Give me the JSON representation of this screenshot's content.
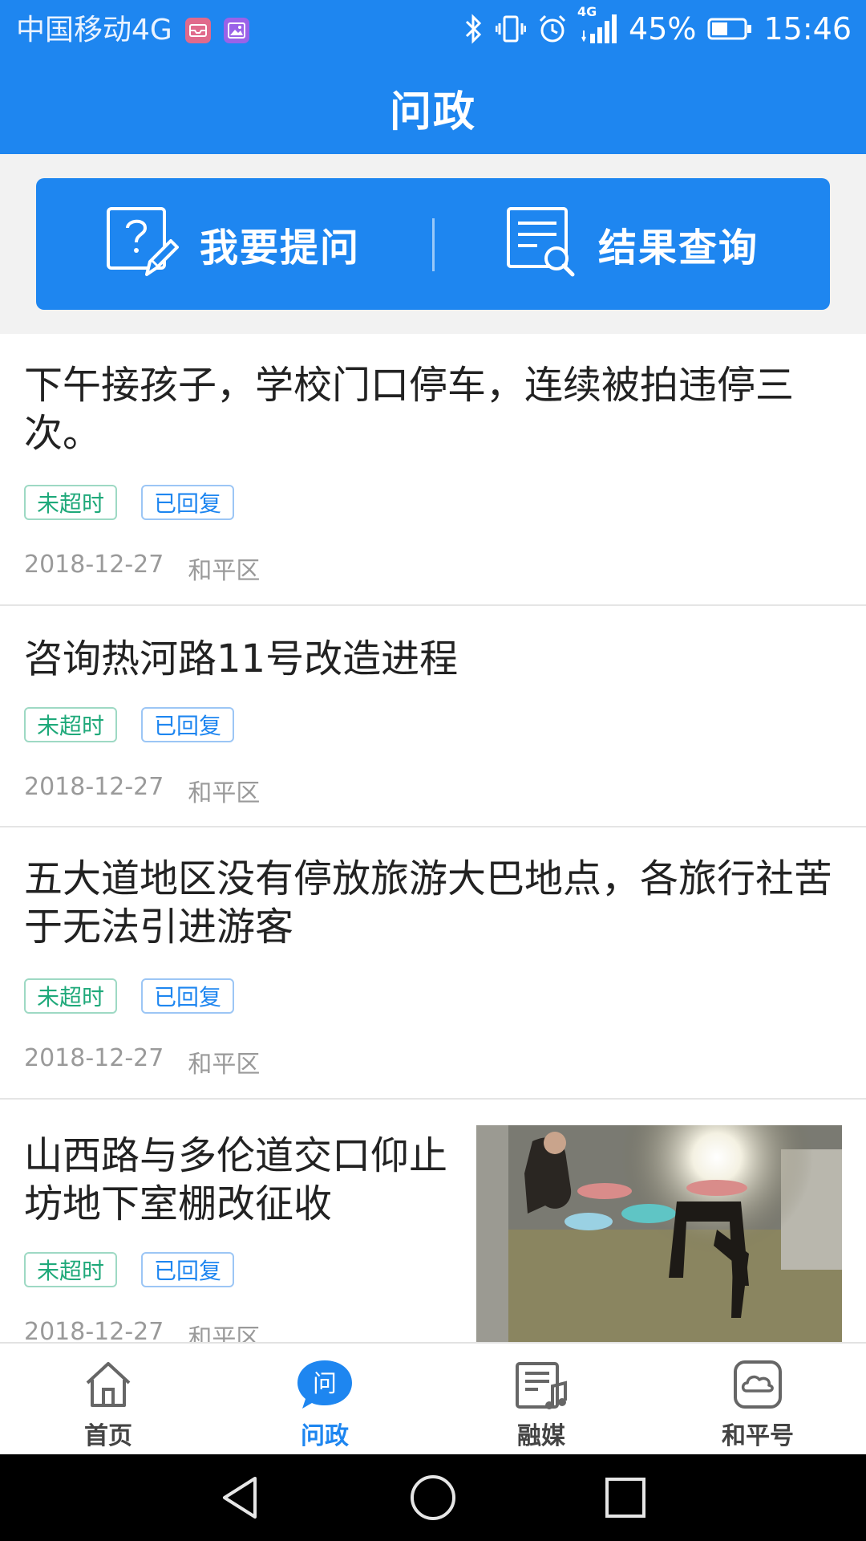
{
  "status_bar": {
    "carrier": "中国移动4G",
    "network_tag": "4G",
    "battery_percent": "45%",
    "time": "15:46"
  },
  "header": {
    "title": "问政"
  },
  "actions": {
    "ask_label": "我要提问",
    "query_label": "结果查询"
  },
  "questions": [
    {
      "title_line1": "下午接孩子，学校门口停车，连续被拍违停三",
      "title_line2": "次。",
      "tag_timeout": "未超时",
      "tag_reply": "已回复",
      "date": "2018-12-27",
      "district": "和平区"
    },
    {
      "title_line1": "咨询热河路11号改造进程",
      "tag_timeout": "未超时",
      "tag_reply": "已回复",
      "date": "2018-12-27",
      "district": "和平区"
    },
    {
      "title_line1": "五大道地区没有停放旅游大巴地点，各旅行社苦",
      "title_line2": "于无法引进游客",
      "tag_timeout": "未超时",
      "tag_reply": "已回复",
      "date": "2018-12-27",
      "district": "和平区"
    },
    {
      "title_line1": "山西路与多伦道交口仰止",
      "title_line2": "坊地下室棚改征收",
      "tag_timeout": "未超时",
      "tag_reply": "已回复",
      "date": "2018-12-27",
      "district": "和平区",
      "has_thumbnail": true
    }
  ],
  "bottom_nav": {
    "items": [
      {
        "label": "首页",
        "icon": "home-icon",
        "active": false
      },
      {
        "label": "问政",
        "icon": "ask-bubble-icon",
        "active": true
      },
      {
        "label": "融媒",
        "icon": "media-icon",
        "active": false
      },
      {
        "label": "和平号",
        "icon": "cloud-icon",
        "active": false
      }
    ]
  },
  "colors": {
    "primary": "#1E86F0",
    "tag_green": "#1FA97A",
    "meta_gray": "#9A9A9A",
    "divider": "#E5E5E5"
  }
}
